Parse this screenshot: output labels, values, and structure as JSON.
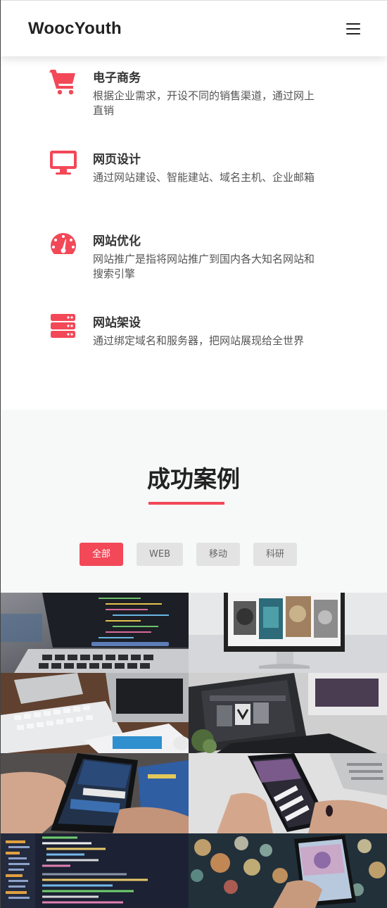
{
  "header": {
    "brand": "WoocYouth",
    "menu_icon": "hamburger-icon"
  },
  "services": [
    {
      "id": "ecommerce",
      "icon": "cart-icon",
      "title": "电子商务",
      "desc": "根据企业需求，开设不同的销售渠道，通过网上直销"
    },
    {
      "id": "webdesign",
      "icon": "monitor-icon",
      "title": "网页设计",
      "desc": "通过网站建设、智能建站、域名主机、企业邮箱"
    },
    {
      "id": "seo",
      "icon": "speedometer-icon",
      "title": "网站优化",
      "desc": "网站推广是指将网站推广到国内各大知名网站和搜索引擎"
    },
    {
      "id": "hosting",
      "icon": "server-icon",
      "title": "网站架设",
      "desc": "通过绑定域名和服务器，把网站展现给全世界"
    }
  ],
  "cases": {
    "title": "成功案例",
    "filters": [
      {
        "label": "全部",
        "active": true
      },
      {
        "label": "WEB",
        "active": false
      },
      {
        "label": "移动",
        "active": false
      },
      {
        "label": "科研",
        "active": false
      }
    ]
  },
  "colors": {
    "accent": "#f24858",
    "section_bg": "#f7f8f8",
    "filter_bg": "#e3e3e3"
  }
}
